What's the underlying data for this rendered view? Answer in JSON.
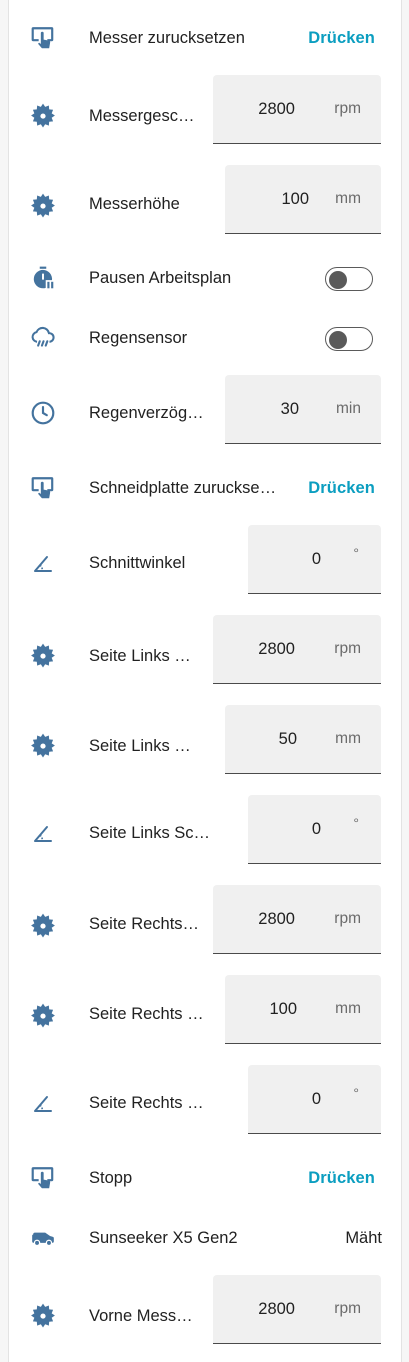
{
  "rows": [
    {
      "name": "Messer zurucksetzen",
      "type": "button",
      "action": "Drücken",
      "icon": "touch-screen-icon"
    },
    {
      "name": "Messergesc…",
      "type": "number",
      "value": "2800",
      "unit": "rpm",
      "icon": "saw-blade-icon"
    },
    {
      "name": "Messerhöhe",
      "type": "number",
      "value": "100",
      "unit": "mm",
      "icon": "saw-blade-icon"
    },
    {
      "name": "Pausen Arbeitsplan",
      "type": "toggle",
      "on": false,
      "icon": "timer-pause-icon"
    },
    {
      "name": "Regensensor",
      "type": "toggle",
      "on": false,
      "icon": "weather-rainy-icon"
    },
    {
      "name": "Regenverzög…",
      "type": "number",
      "value": "30",
      "unit": "min",
      "icon": "clock-icon"
    },
    {
      "name": "Schneidplatte zuruckse…",
      "type": "button",
      "action": "Drücken",
      "icon": "touch-screen-icon"
    },
    {
      "name": "Schnittwinkel",
      "type": "number",
      "value": "0",
      "unit": "°",
      "icon": "angle-acute-icon"
    },
    {
      "name": "Seite Links …",
      "type": "number",
      "value": "2800",
      "unit": "rpm",
      "icon": "saw-blade-icon"
    },
    {
      "name": "Seite Links …",
      "type": "number",
      "value": "50",
      "unit": "mm",
      "icon": "saw-blade-icon"
    },
    {
      "name": "Seite Links Sc…",
      "type": "number",
      "value": "0",
      "unit": "°",
      "icon": "angle-acute-icon"
    },
    {
      "name": "Seite Rechts…",
      "type": "number",
      "value": "2800",
      "unit": "rpm",
      "icon": "saw-blade-icon"
    },
    {
      "name": "Seite Rechts …",
      "type": "number",
      "value": "100",
      "unit": "mm",
      "icon": "saw-blade-icon"
    },
    {
      "name": "Seite Rechts …",
      "type": "number",
      "value": "0",
      "unit": "°",
      "icon": "angle-acute-icon"
    },
    {
      "name": "Stopp",
      "type": "button",
      "action": "Drücken",
      "icon": "touch-screen-icon"
    },
    {
      "name": "Sunseeker X5 Gen2",
      "type": "state",
      "value": "Mäht",
      "icon": "robot-mower-icon"
    },
    {
      "name": "Vorne Mess…",
      "type": "number",
      "value": "2800",
      "unit": "rpm",
      "icon": "saw-blade-icon"
    }
  ],
  "colors": {
    "icon": "#44739e",
    "accent": "#0b9ec0",
    "field_bg": "#f0f0f0"
  }
}
